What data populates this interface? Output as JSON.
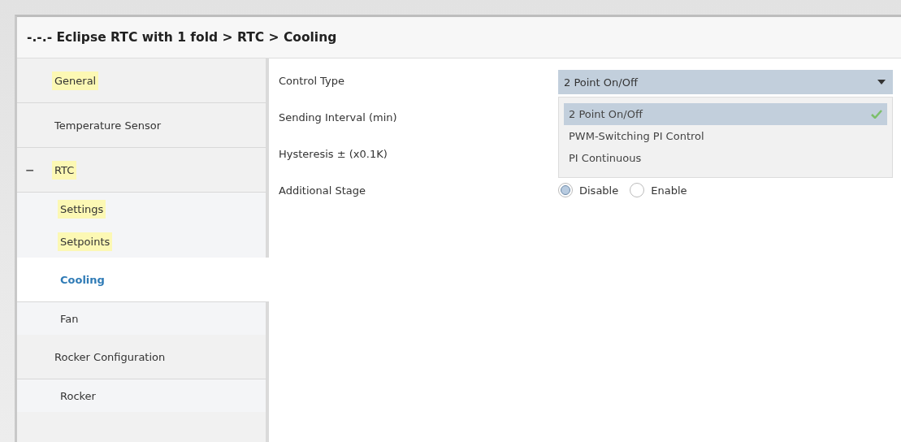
{
  "window": {
    "title": "-.-.- Eclipse RTC with 1 fold > RTC > Cooling"
  },
  "sidebar": {
    "items": [
      {
        "label": "General",
        "highlighted": true,
        "selected": false
      },
      {
        "label": "Temperature Sensor",
        "highlighted": false,
        "selected": false
      },
      {
        "label": "RTC",
        "highlighted": true,
        "selected": false,
        "expanded": true,
        "toggle": "−",
        "children": [
          {
            "label": "Settings",
            "highlighted": true,
            "selected": false
          },
          {
            "label": "Setpoints",
            "highlighted": true,
            "selected": false
          },
          {
            "label": "Cooling",
            "highlighted": false,
            "selected": true
          },
          {
            "label": "Fan",
            "highlighted": false,
            "selected": false
          }
        ]
      },
      {
        "label": "Rocker Configuration",
        "highlighted": false,
        "selected": false,
        "children": [
          {
            "label": "Rocker",
            "highlighted": false,
            "selected": false
          }
        ]
      }
    ]
  },
  "parameters": [
    {
      "label": "Control Type",
      "kind": "dropdown",
      "value": "2 Point On/Off",
      "expanded": true,
      "options": [
        {
          "label": "2 Point On/Off",
          "selected": true
        },
        {
          "label": "PWM-Switching PI Control",
          "selected": false
        },
        {
          "label": "PI Continuous",
          "selected": false
        }
      ]
    },
    {
      "label": "Sending Interval (min)",
      "kind": "hidden"
    },
    {
      "label": "Hysteresis ± (x0.1K)",
      "kind": "hidden"
    },
    {
      "label": "Additional Stage",
      "kind": "radio",
      "options": [
        {
          "label": "Disable",
          "selected": true
        },
        {
          "label": "Enable",
          "selected": false
        }
      ]
    }
  ]
}
